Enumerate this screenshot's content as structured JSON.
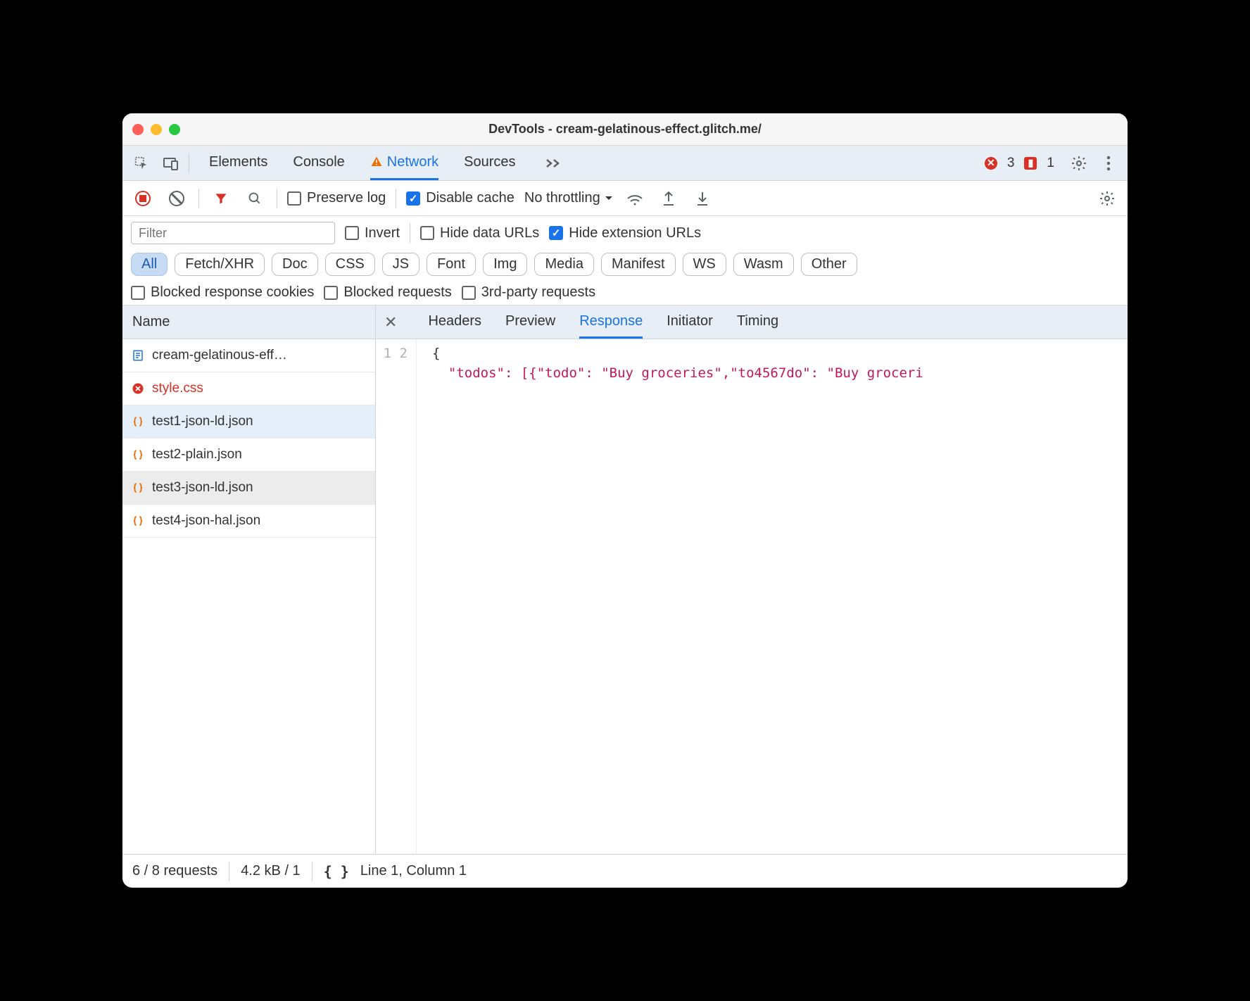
{
  "window": {
    "title": "DevTools - cream-gelatinous-effect.glitch.me/"
  },
  "tabs": {
    "elements": "Elements",
    "console": "Console",
    "network": "Network",
    "sources": "Sources"
  },
  "badges": {
    "errors": "3",
    "issues": "1"
  },
  "toolbar2": {
    "preserve_log": "Preserve log",
    "disable_cache": "Disable cache",
    "throttling": "No throttling"
  },
  "filterrow": {
    "placeholder": "Filter",
    "invert": "Invert",
    "hide_data_urls": "Hide data URLs",
    "hide_ext_urls": "Hide extension URLs"
  },
  "type_filters": {
    "all": "All",
    "fetchxhr": "Fetch/XHR",
    "doc": "Doc",
    "css": "CSS",
    "js": "JS",
    "font": "Font",
    "img": "Img",
    "media": "Media",
    "manifest": "Manifest",
    "ws": "WS",
    "wasm": "Wasm",
    "other": "Other"
  },
  "more_filters": {
    "blocked_cookies": "Blocked response cookies",
    "blocked_requests": "Blocked requests",
    "third_party": "3rd-party requests"
  },
  "sidebar": {
    "header": "Name"
  },
  "requests": [
    {
      "name": "cream-gelatinous-eff…",
      "type": "doc"
    },
    {
      "name": "style.css",
      "type": "err"
    },
    {
      "name": "test1-json-ld.json",
      "type": "json"
    },
    {
      "name": "test2-plain.json",
      "type": "json"
    },
    {
      "name": "test3-json-ld.json",
      "type": "json"
    },
    {
      "name": "test4-json-hal.json",
      "type": "json"
    }
  ],
  "detail_tabs": {
    "headers": "Headers",
    "preview": "Preview",
    "response": "Response",
    "initiator": "Initiator",
    "timing": "Timing"
  },
  "response": {
    "line1": "{",
    "line2": "  \"todos\": [{\"todo\": \"Buy groceries\",\"to4567do\": \"Buy groceri"
  },
  "status": {
    "requests": "6 / 8 requests",
    "transferred": "4.2 kB / 1",
    "cursor": "Line 1, Column 1"
  }
}
